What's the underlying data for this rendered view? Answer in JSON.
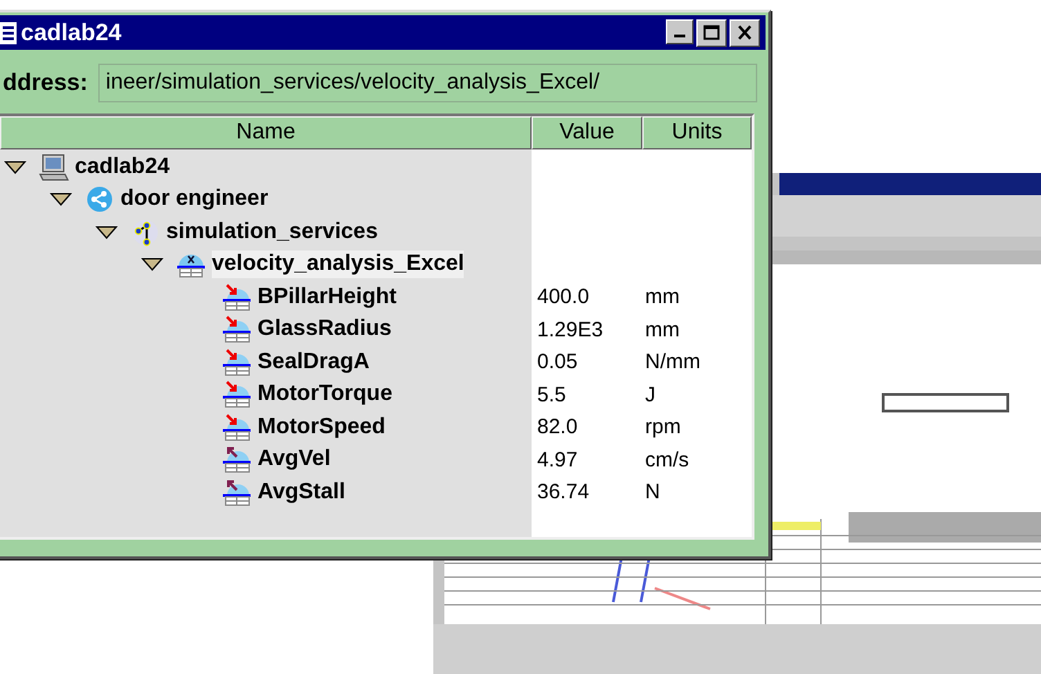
{
  "window": {
    "title": "cadlab24",
    "controls": [
      {
        "kind": "minimize"
      },
      {
        "kind": "maximize"
      },
      {
        "kind": "close"
      }
    ]
  },
  "address": {
    "label": "ddress:",
    "value": "ineer/simulation_services/velocity_analysis_Excel/"
  },
  "table": {
    "columns": [
      "Name",
      "Value",
      "Units"
    ],
    "tree": [
      {
        "name": "cadlab24",
        "kind": "computer",
        "expanded": true,
        "selected": false,
        "children": [
          {
            "name": "door engineer",
            "kind": "network",
            "expanded": true,
            "selected": false,
            "children": [
              {
                "name": "simulation_services",
                "kind": "services",
                "expanded": true,
                "selected": false,
                "children": [
                  {
                    "name": "velocity_analysis_Excel",
                    "kind": "model",
                    "expanded": true,
                    "selected": true,
                    "children": [
                      {
                        "name": "BPillarHeight",
                        "kind": "input",
                        "value": "400.0",
                        "units": "mm",
                        "selected": false
                      },
                      {
                        "name": "GlassRadius",
                        "kind": "input",
                        "value": "1.29E3",
                        "units": "mm",
                        "selected": false
                      },
                      {
                        "name": "SealDragA",
                        "kind": "input",
                        "value": "0.05",
                        "units": "N/mm",
                        "selected": false
                      },
                      {
                        "name": "MotorTorque",
                        "kind": "input",
                        "value": "5.5",
                        "units": "J",
                        "selected": false
                      },
                      {
                        "name": "MotorSpeed",
                        "kind": "input",
                        "value": "82.0",
                        "units": "rpm",
                        "selected": false
                      },
                      {
                        "name": "AvgVel",
                        "kind": "output",
                        "value": "4.97",
                        "units": "cm/s",
                        "selected": false
                      },
                      {
                        "name": "AvgStall",
                        "kind": "output",
                        "value": "36.74",
                        "units": "N",
                        "selected": false
                      }
                    ]
                  }
                ]
              }
            ]
          }
        ]
      }
    ]
  }
}
